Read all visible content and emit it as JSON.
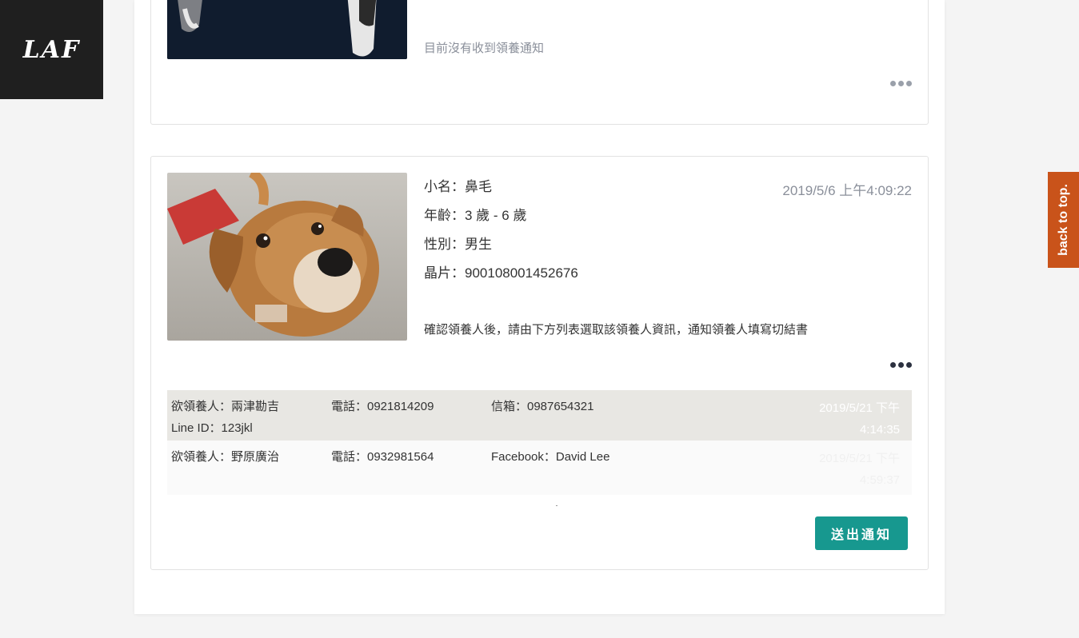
{
  "logo": {
    "text": "LAF"
  },
  "back_to_top": {
    "label": "back to top."
  },
  "card_previous": {
    "notice": "目前沒有收到領養通知"
  },
  "card_pet": {
    "fields": [
      {
        "label": "小名：",
        "value": "鼻毛"
      },
      {
        "label": "年齡：",
        "value": "3 歲 - 6 歲"
      },
      {
        "label": "性別：",
        "value": "男生"
      },
      {
        "label": "晶片：",
        "value": "900108001452676"
      }
    ],
    "timestamp": "2019/5/6 上午4:09:22",
    "instruction": "確認領養人後，請由下方列表選取該領養人資訊，通知領養人填寫切結書",
    "applicants": [
      {
        "name": "欲領養人：兩津勘吉",
        "phone": "電話：0921814209",
        "contact": "信箱：0987654321",
        "extra": "Line ID：123jkl",
        "time_line1": "2019/5/21 下午",
        "time_line2": "4:14:35"
      },
      {
        "name": "欲領養人：野原廣治",
        "phone": "電話：0932981564",
        "contact": "Facebook：David Lee",
        "extra": "",
        "time_line1": "2019/5/21 下午",
        "time_line2": "4:59:37"
      }
    ],
    "send_button": "送出通知"
  },
  "colors": {
    "accent": "#17988f",
    "back_to_top": "#c9531a",
    "logo_bg": "#1f1f1f",
    "selected_row": "#e8e7e3"
  }
}
